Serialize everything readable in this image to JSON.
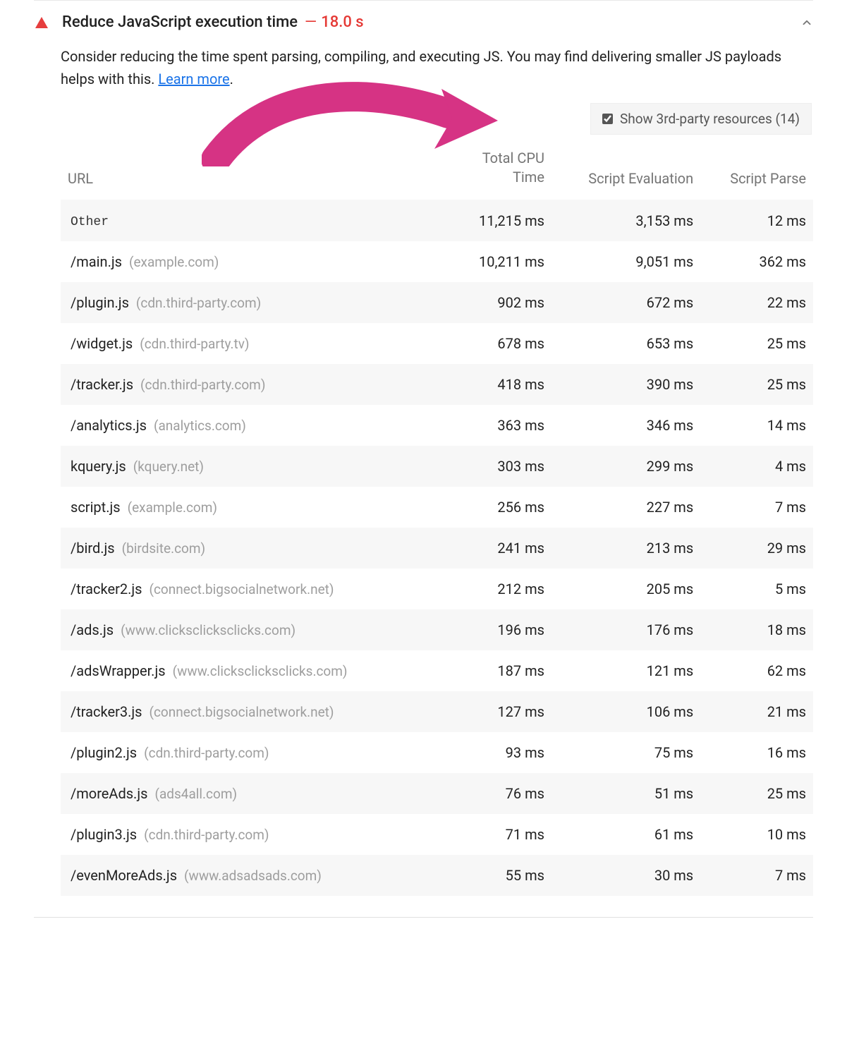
{
  "header": {
    "title": "Reduce JavaScript execution time",
    "dash": "—",
    "time": "18.0 s"
  },
  "description": {
    "text": "Consider reducing the time spent parsing, compiling, and executing JS. You may find delivering smaller JS payloads helps with this. ",
    "learnMore": "Learn more"
  },
  "thirdPartyToggle": {
    "label": "Show 3rd-party resources (14)",
    "checked": true
  },
  "columns": {
    "url": "URL",
    "cpu": "Total CPU Time",
    "eval": "Script Evaluation",
    "parse": "Script Parse"
  },
  "rows": [
    {
      "path": "Other",
      "host": "",
      "isOther": true,
      "cpu": "11,215 ms",
      "eval": "3,153 ms",
      "parse": "12 ms"
    },
    {
      "path": "/main.js",
      "host": "(example.com)",
      "cpu": "10,211 ms",
      "eval": "9,051 ms",
      "parse": "362 ms"
    },
    {
      "path": "/plugin.js",
      "host": "(cdn.third-party.com)",
      "cpu": "902 ms",
      "eval": "672 ms",
      "parse": "22 ms"
    },
    {
      "path": "/widget.js",
      "host": "(cdn.third-party.tv)",
      "cpu": "678 ms",
      "eval": "653 ms",
      "parse": "25 ms"
    },
    {
      "path": "/tracker.js",
      "host": "(cdn.third-party.com)",
      "cpu": "418 ms",
      "eval": "390 ms",
      "parse": "25 ms"
    },
    {
      "path": "/analytics.js",
      "host": "(analytics.com)",
      "cpu": "363 ms",
      "eval": "346 ms",
      "parse": "14 ms"
    },
    {
      "path": "kquery.js",
      "host": "(kquery.net)",
      "cpu": "303 ms",
      "eval": "299 ms",
      "parse": "4 ms"
    },
    {
      "path": "script.js",
      "host": "(example.com)",
      "cpu": "256 ms",
      "eval": "227 ms",
      "parse": "7 ms"
    },
    {
      "path": "/bird.js",
      "host": "(birdsite.com)",
      "cpu": "241 ms",
      "eval": "213 ms",
      "parse": "29 ms"
    },
    {
      "path": "/tracker2.js",
      "host": "(connect.bigsocialnetwork.net)",
      "cpu": "212 ms",
      "eval": "205 ms",
      "parse": "5 ms"
    },
    {
      "path": "/ads.js",
      "host": "(www.clicksclicksclicks.com)",
      "cpu": "196 ms",
      "eval": "176 ms",
      "parse": "18 ms"
    },
    {
      "path": "/adsWrapper.js",
      "host": "(www.clicksclicksclicks.com)",
      "cpu": "187 ms",
      "eval": "121 ms",
      "parse": "62 ms"
    },
    {
      "path": "/tracker3.js",
      "host": "(connect.bigsocialnetwork.net)",
      "cpu": "127 ms",
      "eval": "106 ms",
      "parse": "21 ms"
    },
    {
      "path": "/plugin2.js",
      "host": "(cdn.third-party.com)",
      "cpu": "93 ms",
      "eval": "75 ms",
      "parse": "16 ms"
    },
    {
      "path": "/moreAds.js",
      "host": "(ads4all.com)",
      "cpu": "76 ms",
      "eval": "51 ms",
      "parse": "25 ms"
    },
    {
      "path": "/plugin3.js",
      "host": "(cdn.third-party.com)",
      "cpu": "71 ms",
      "eval": "61 ms",
      "parse": "10 ms"
    },
    {
      "path": "/evenMoreAds.js",
      "host": "(www.adsadsads.com)",
      "cpu": "55 ms",
      "eval": "30 ms",
      "parse": "7 ms"
    }
  ]
}
